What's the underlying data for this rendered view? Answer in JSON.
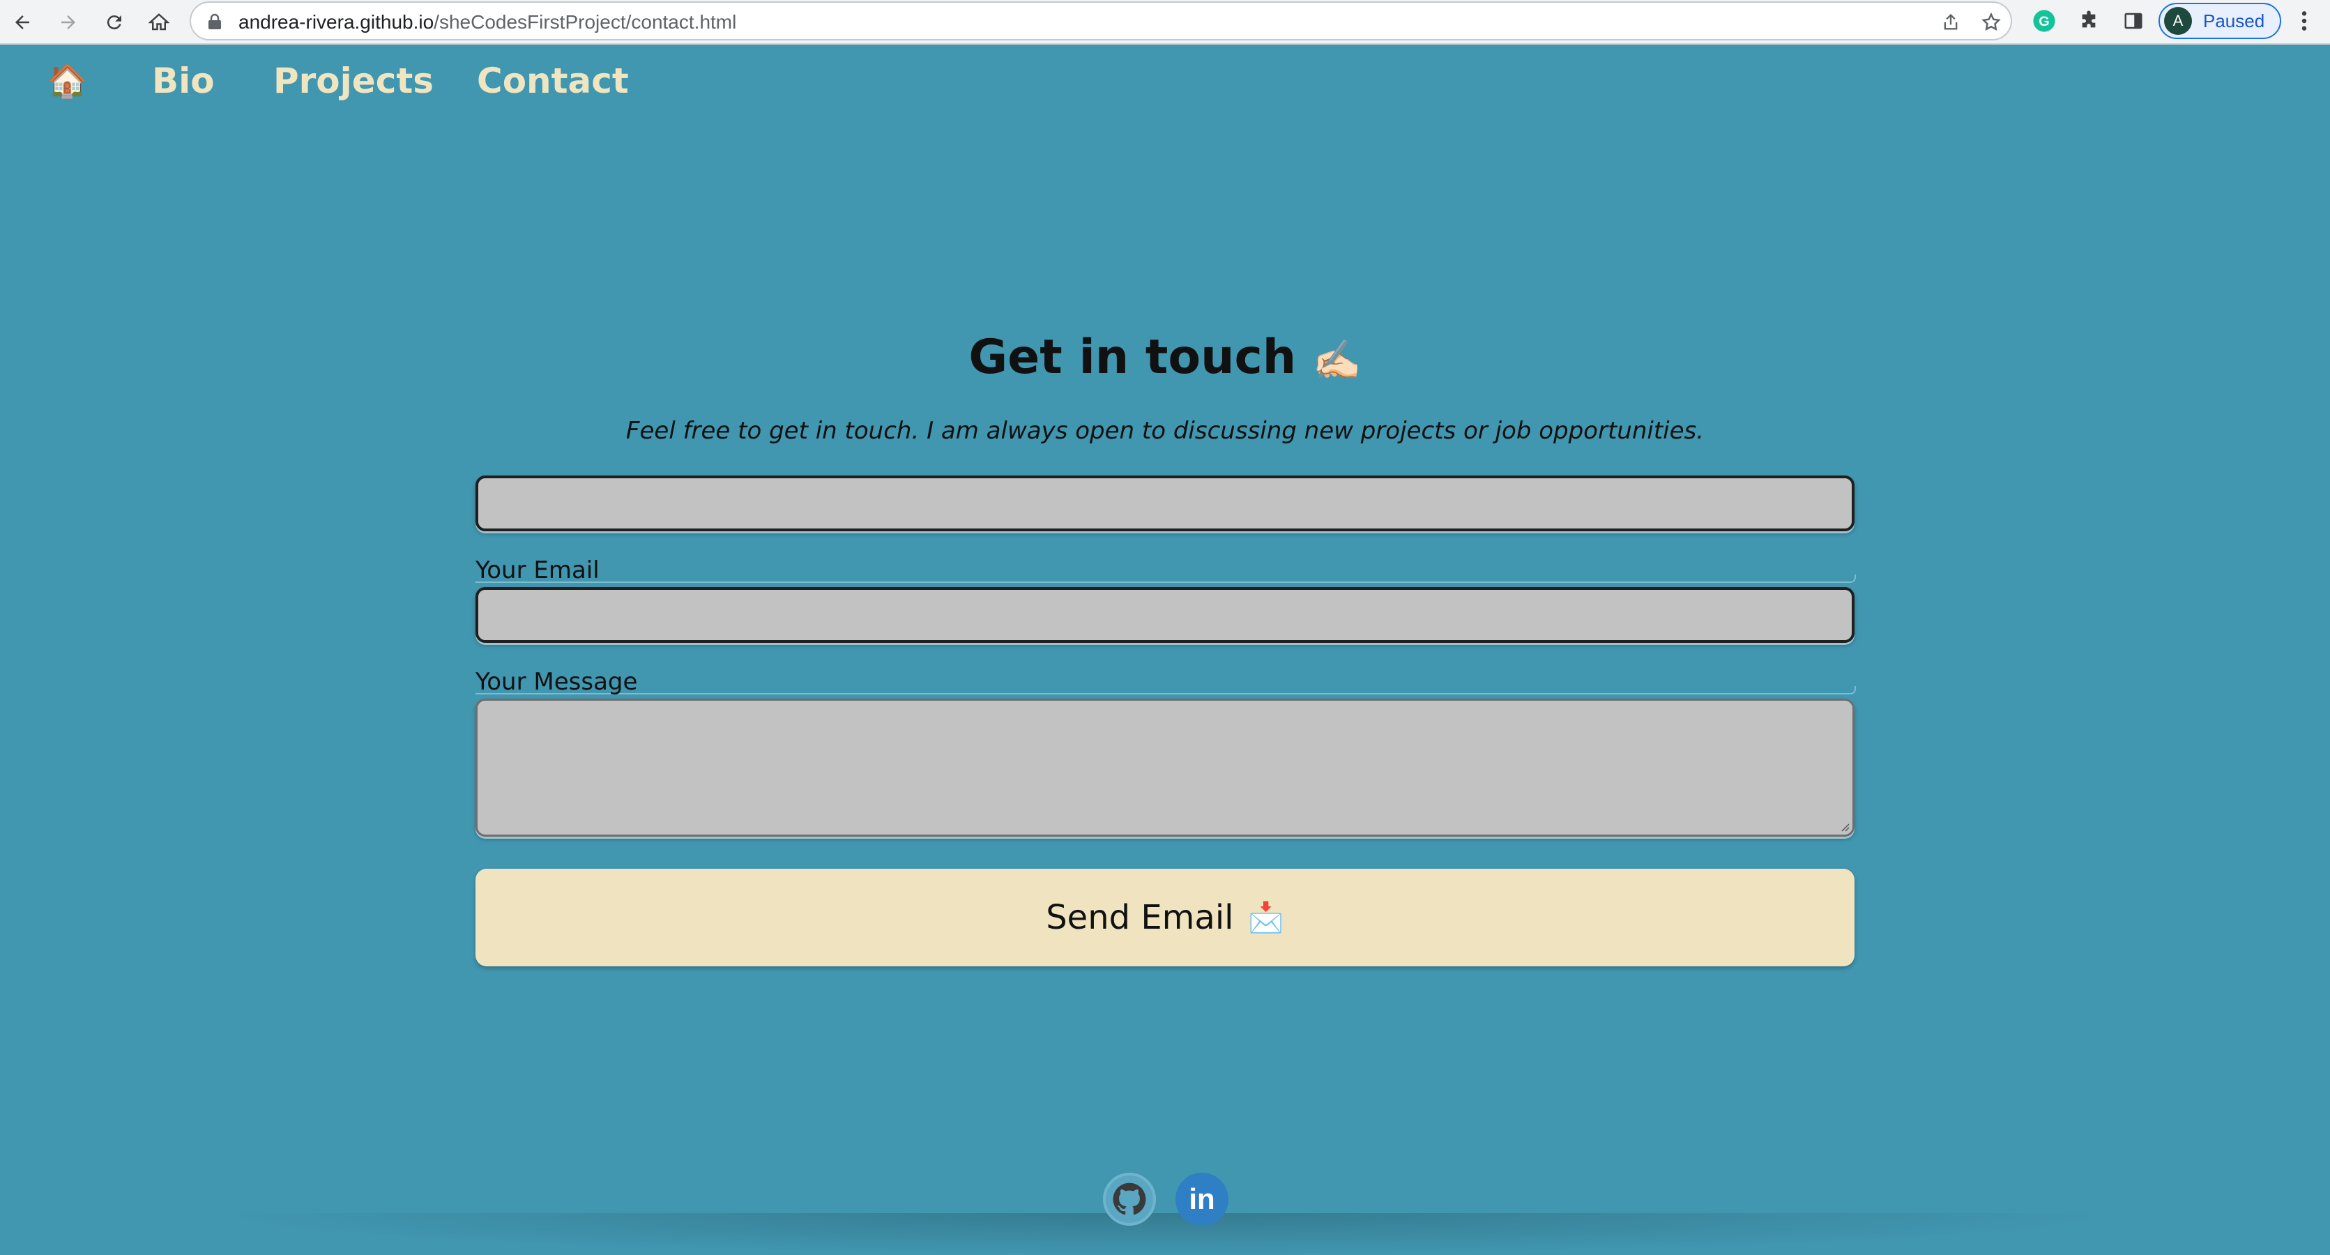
{
  "browser": {
    "url_host": "andrea-rivera.github.io",
    "url_path": "/sheCodesFirstProject/contact.html",
    "profile_initial": "A",
    "profile_status": "Paused",
    "icons": [
      "back-icon",
      "forward-icon",
      "reload-icon",
      "home-icon",
      "lock-icon",
      "share-icon",
      "bookmark-star-icon",
      "grammarly-icon",
      "extensions-puzzle-icon",
      "side-panel-icon",
      "more-menu-icon"
    ]
  },
  "nav": {
    "home_icon": "🏠",
    "items": [
      "Bio",
      "Projects",
      "Contact"
    ]
  },
  "main": {
    "heading": "Get in touch",
    "heading_emoji": "✍🏻",
    "subtitle": "Feel free to get in touch. I am always open to discussing new projects or job opportunities.",
    "name_value": "",
    "email_label": "Your Email",
    "email_value": "",
    "message_label": "Your Message",
    "message_value": "",
    "send_label": "Send Email",
    "send_emoji": "📩"
  },
  "footer": {
    "links": [
      "github-icon",
      "linkedin-icon"
    ],
    "linkedin_text": "in"
  },
  "colors": {
    "background": "#4196b0",
    "nav_text": "#efe5c0",
    "button_bg": "#efe4bf",
    "input_bg": "#c2c2c2"
  }
}
